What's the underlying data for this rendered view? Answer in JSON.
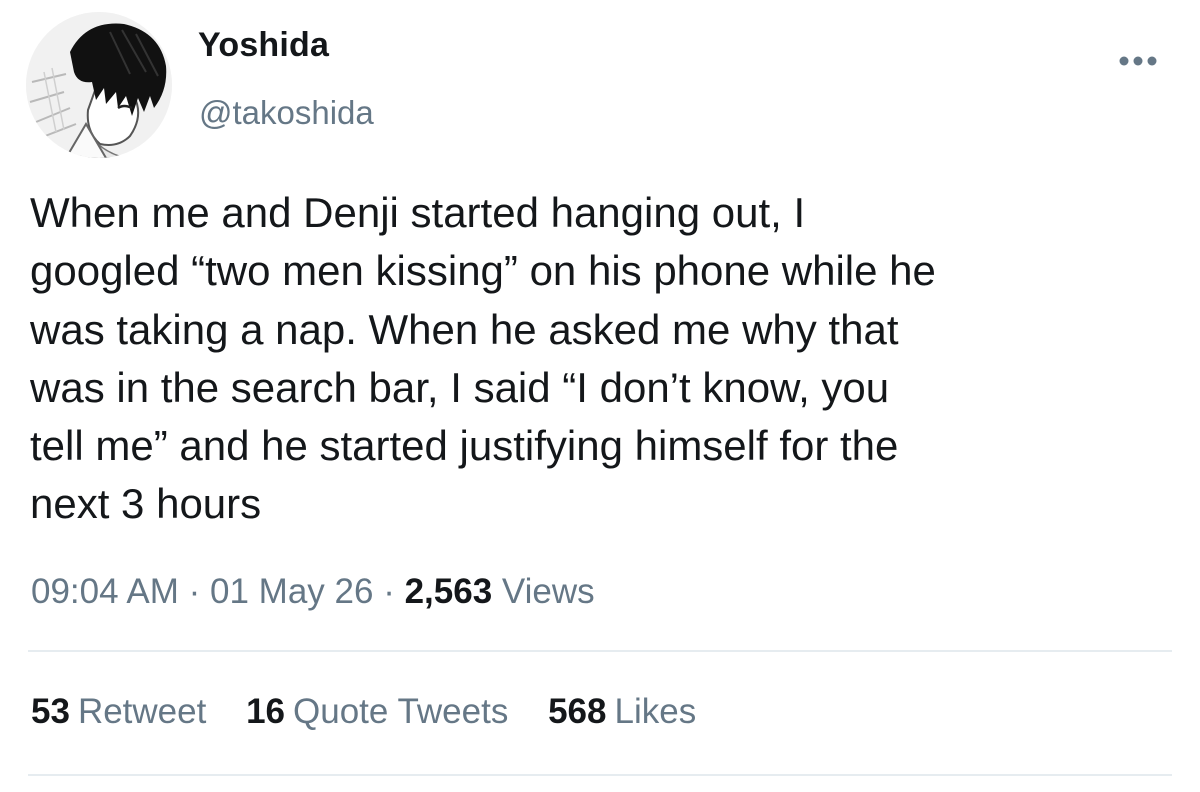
{
  "author": {
    "display_name": "Yoshida",
    "handle": "@takoshida"
  },
  "menu": {
    "icon": "more-horizontal-icon"
  },
  "tweet": {
    "text": "When me and Denji started hanging out, I\ngoogled “two men kissing” on his phone while he\nwas taking a nap. When he asked me why that\nwas in the search bar, I said “I don’t know, you\ntell me” and he started justifying himself for the\nnext 3 hours"
  },
  "meta": {
    "time": "09:04 AM",
    "separator": "·",
    "date": "01 May 26",
    "views_count": "2,563",
    "views_label": "Views"
  },
  "stats": {
    "retweets": {
      "count": "53",
      "label": "Retweet"
    },
    "quotes": {
      "count": "16",
      "label": "Quote Tweets"
    },
    "likes": {
      "count": "568",
      "label": "Likes"
    }
  },
  "colors": {
    "text_primary": "#14171a",
    "text_secondary": "#657786",
    "divider": "#e6ecf0"
  }
}
